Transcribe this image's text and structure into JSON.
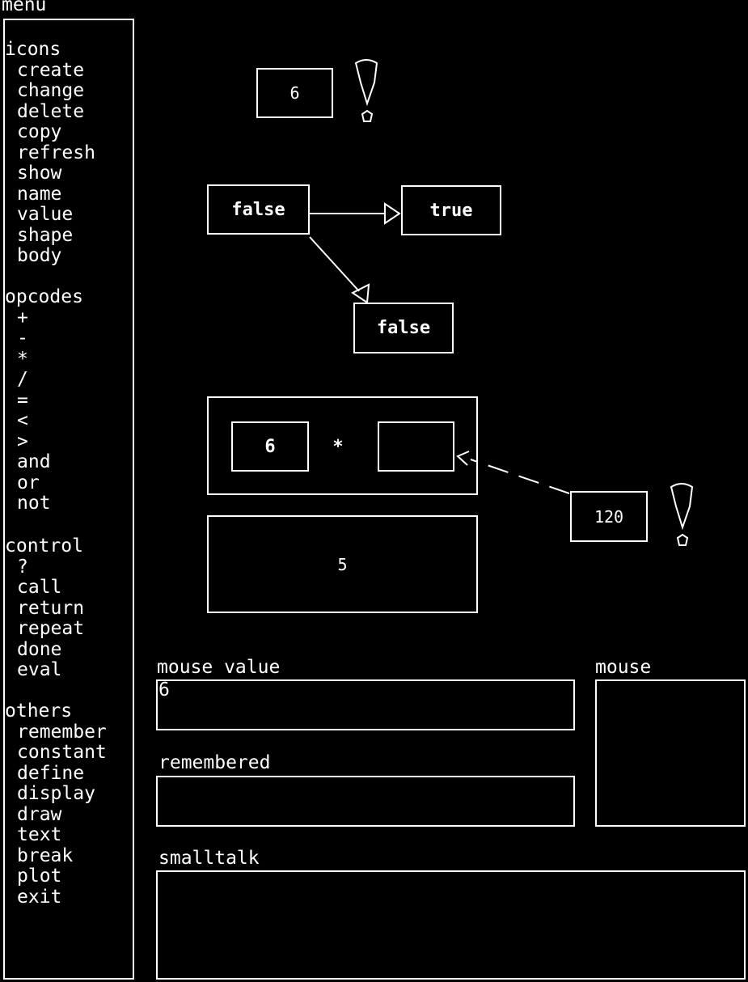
{
  "menu": {
    "title": "menu",
    "sections": [
      {
        "heading": "icons",
        "items": [
          "create",
          "change",
          "delete",
          "copy",
          "refresh",
          "show",
          "name",
          "value",
          "shape",
          "body"
        ]
      },
      {
        "heading": "opcodes",
        "items": [
          "+",
          "-",
          "*",
          "/",
          "=",
          "<",
          ">",
          "and",
          "or",
          "not"
        ]
      },
      {
        "heading": "control",
        "items": [
          "?",
          "call",
          "return",
          "repeat",
          "done",
          "eval"
        ]
      },
      {
        "heading": "others",
        "items": [
          "remember",
          "constant",
          "define",
          "display",
          "draw",
          "text",
          "break",
          "plot",
          "exit"
        ]
      }
    ]
  },
  "canvas": {
    "icon_six_top": "6",
    "icon_false_1": "false",
    "icon_true": "true",
    "icon_false_2": "false",
    "expr_left": "6",
    "expr_operator": "*",
    "expr_right": "",
    "icon_120": "120",
    "icon_five": "5"
  },
  "panels": {
    "mouse_value_label": "mouse value",
    "mouse_value": "6",
    "mouse_label": "mouse",
    "remembered_label": "remembered",
    "remembered_value": "",
    "smalltalk_label": "smalltalk",
    "smalltalk_value": ""
  },
  "icons": [
    "exclamation-icon",
    "arrow-icon"
  ]
}
